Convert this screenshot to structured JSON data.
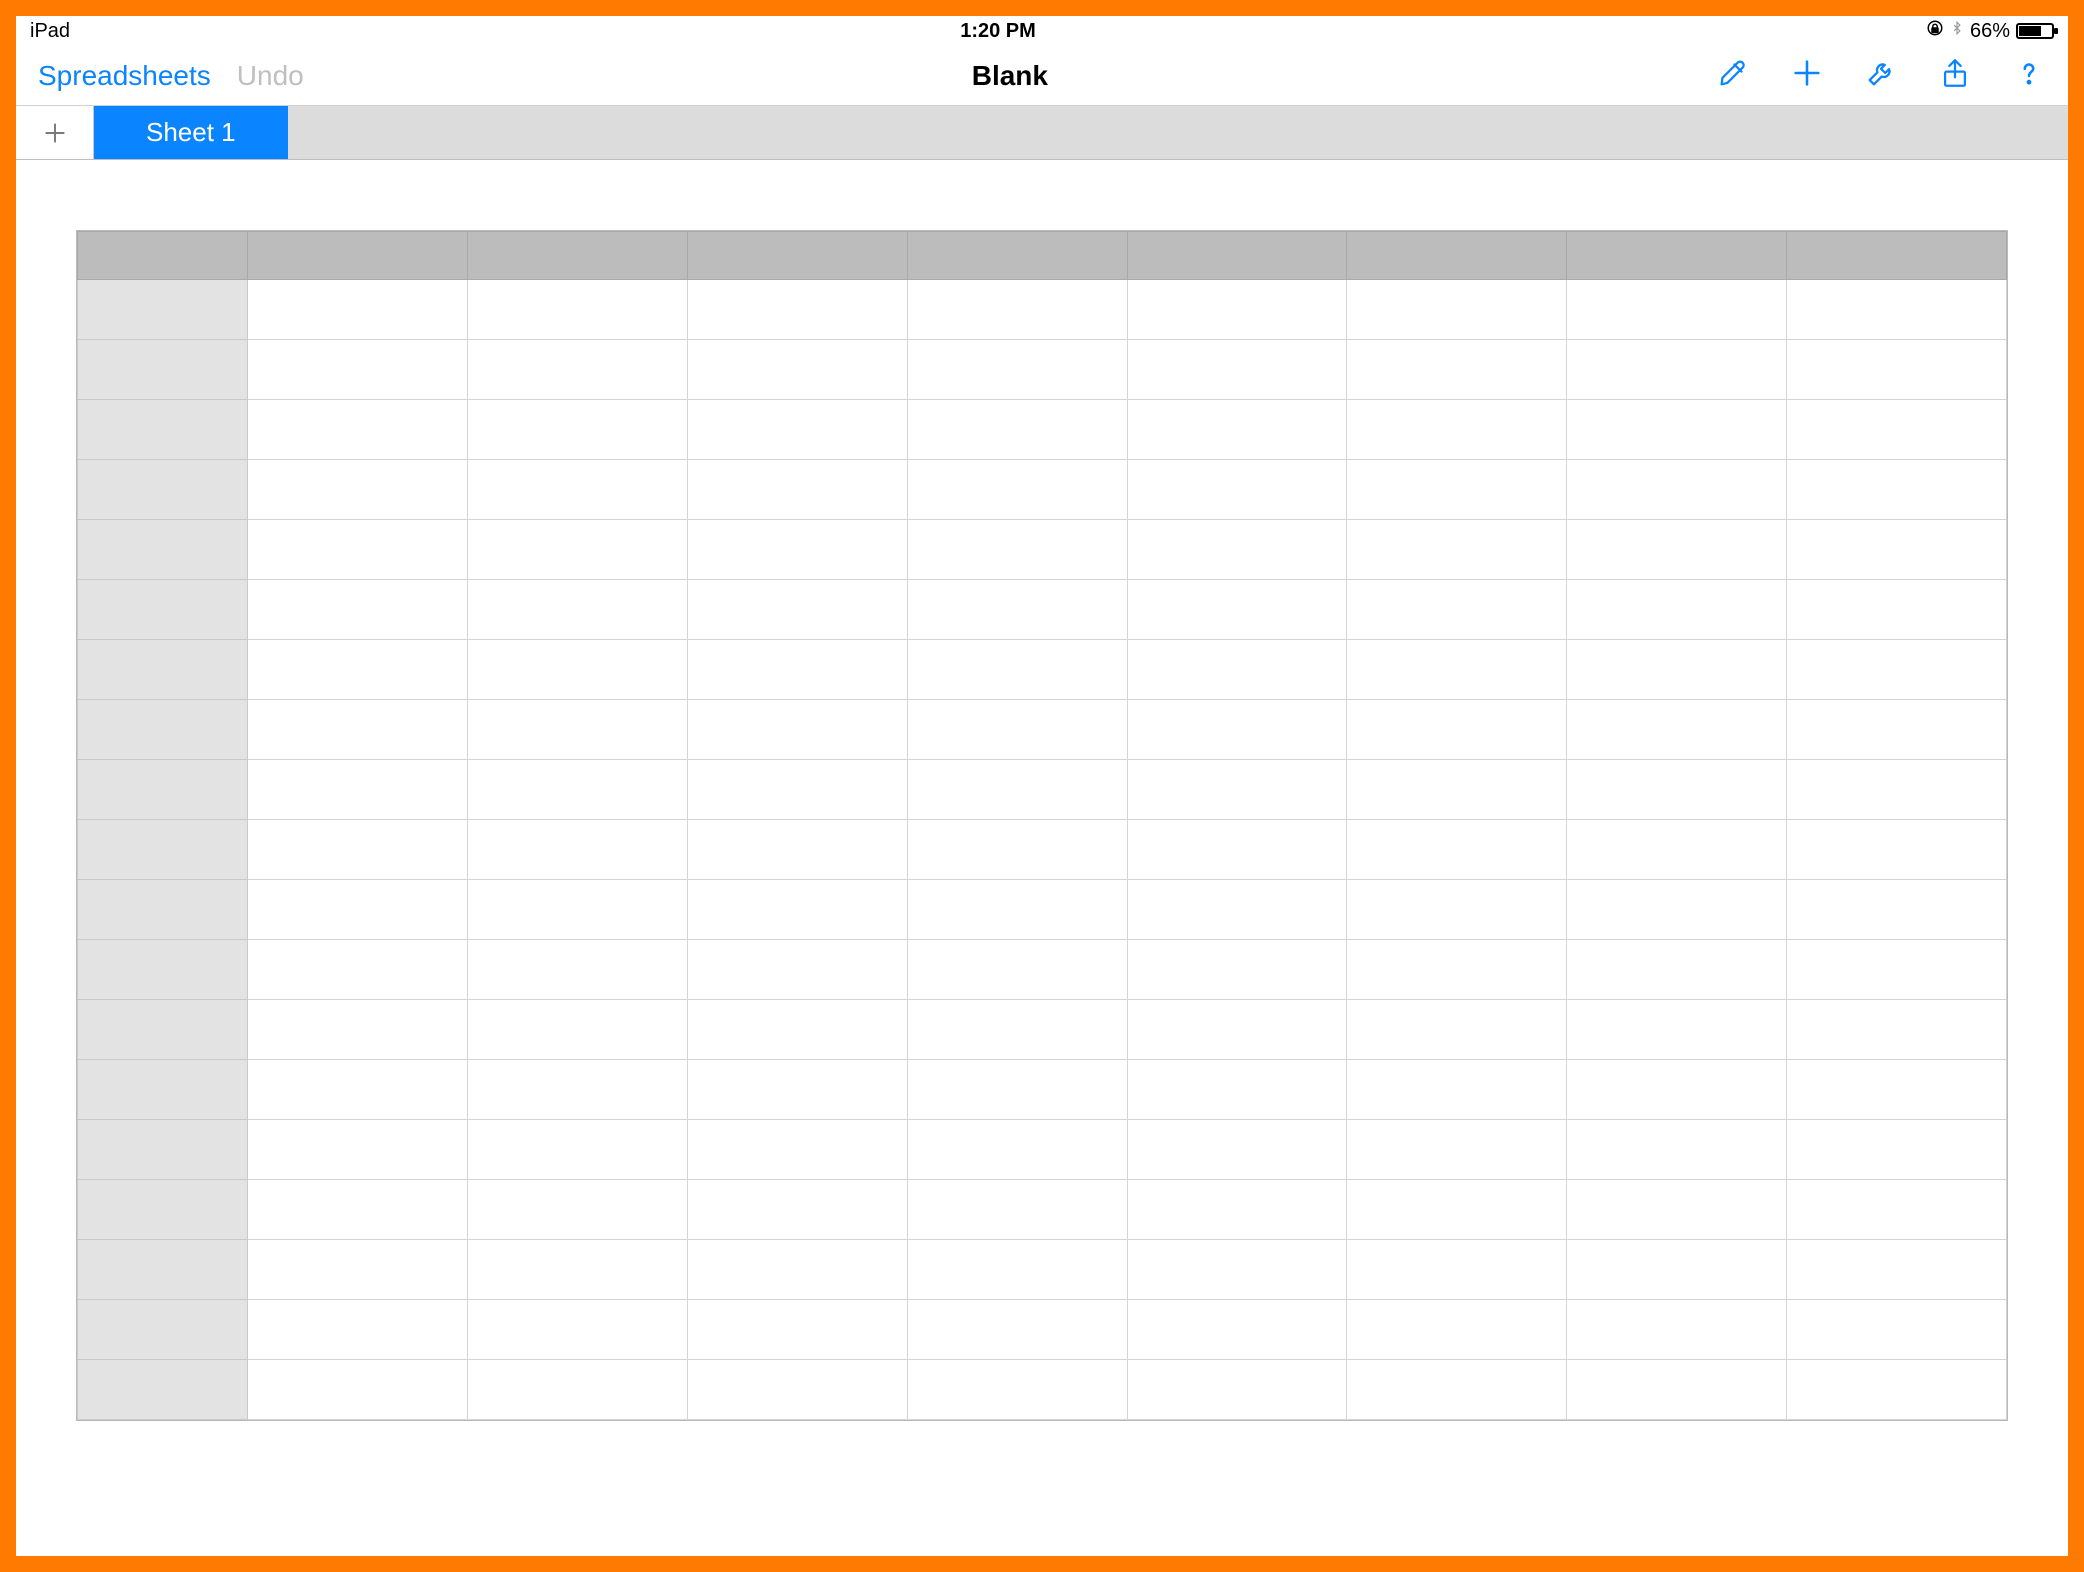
{
  "status": {
    "device": "iPad",
    "time": "1:20 PM",
    "battery_pct": "66%"
  },
  "toolbar": {
    "back_label": "Spreadsheets",
    "undo_label": "Undo",
    "title": "Blank"
  },
  "tabs": {
    "active": "Sheet 1"
  },
  "grid": {
    "cols": 9,
    "rows": 19
  },
  "colors": {
    "frame": "#ff7a00",
    "accent": "#0a84ff",
    "col_header": "#bcbcbc",
    "row_header": "#e3e3e3",
    "tabbar": "#dcdcdc"
  }
}
